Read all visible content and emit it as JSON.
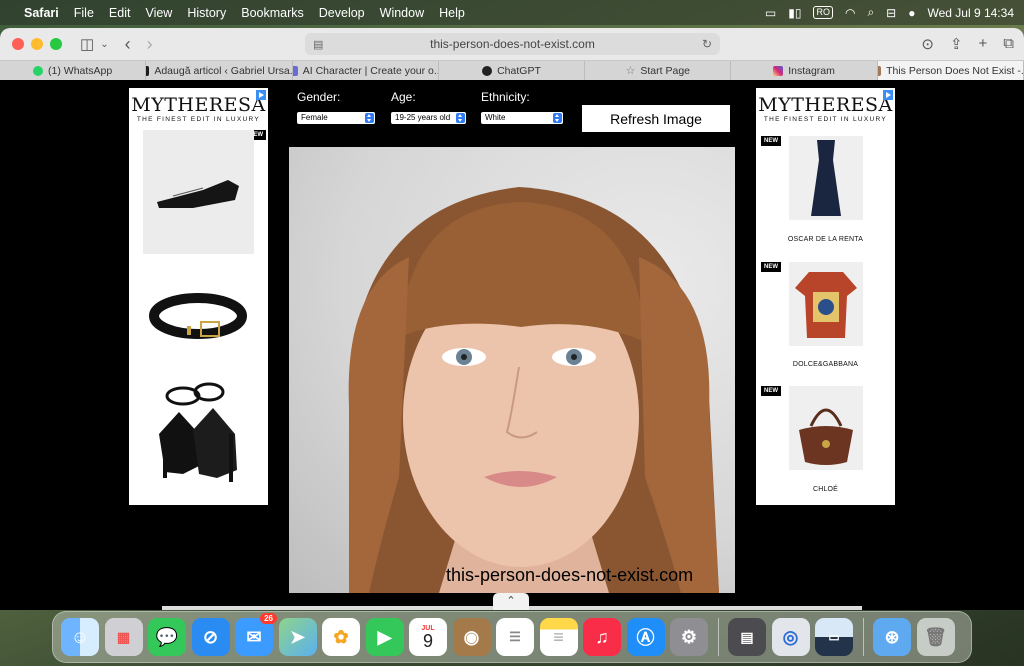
{
  "menubar": {
    "app_name": "Safari",
    "menus": [
      "File",
      "Edit",
      "View",
      "History",
      "Bookmarks",
      "Develop",
      "Window",
      "Help"
    ],
    "input_source": "RO",
    "datetime": "Wed Jul 9  14:34"
  },
  "browser": {
    "url": "this-person-does-not-exist.com",
    "tabs": [
      {
        "label": "(1) WhatsApp",
        "color": "#25d366"
      },
      {
        "label": "Adaugă articol ‹ Gabriel Ursa...",
        "color": "#1d1d1d"
      },
      {
        "label": "AI Character | Create your o...",
        "color": "#6b6bd6"
      },
      {
        "label": "ChatGPT",
        "color": "#222222"
      },
      {
        "label": "Start Page",
        "color": "#888888"
      },
      {
        "label": "Instagram",
        "color": "#d62976"
      },
      {
        "label": "This Person Does Not Exist -...",
        "color": "#a0785a"
      }
    ]
  },
  "ads": {
    "brand": "MYTHERESA",
    "tagline": "THE FINEST EDIT IN LUXURY",
    "new_label": "NEW",
    "right_products": [
      {
        "label": "OSCAR DE LA RENTA"
      },
      {
        "label": "DOLCE&GABBANA"
      },
      {
        "label": "CHLOÉ"
      }
    ]
  },
  "controls": {
    "gender_label": "Gender:",
    "gender_value": "Female",
    "age_label": "Age:",
    "age_value": "19-25 years old",
    "ethnicity_label": "Ethnicity:",
    "ethnicity_value": "White",
    "refresh_label": "Refresh Image"
  },
  "watermark": "this-person-does-not-exist.com",
  "dock": {
    "calendar_month": "JUL",
    "calendar_day": "9",
    "mail_badge": "26"
  }
}
